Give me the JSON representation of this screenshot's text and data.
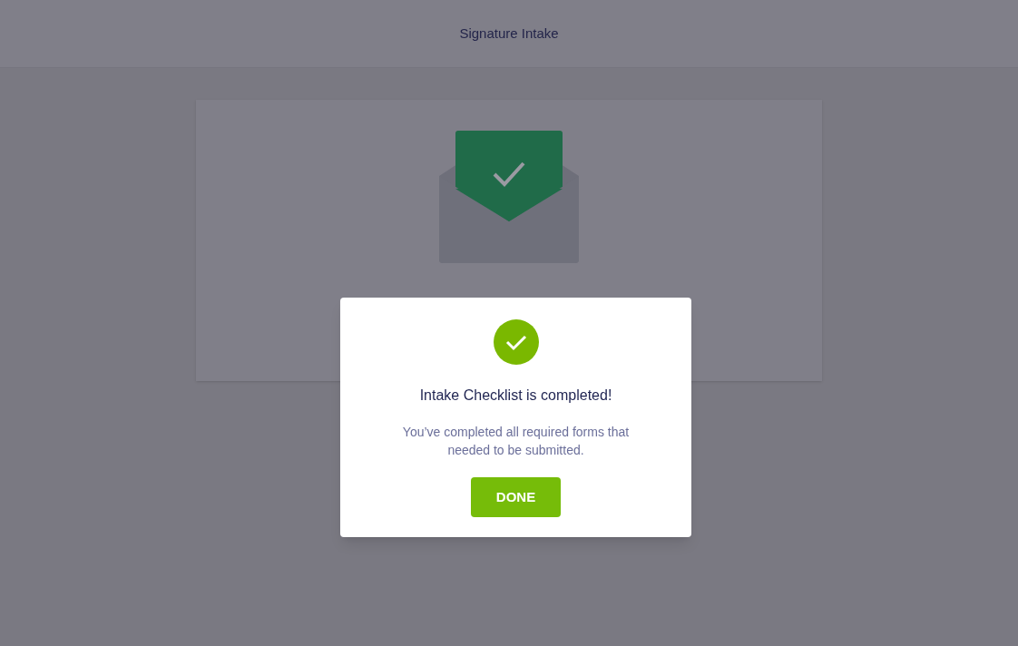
{
  "header": {
    "title": "Signature Intake"
  },
  "modal": {
    "title": "Intake Checklist is completed!",
    "message": "You’ve completed all required forms that needed to be submitted.",
    "button": "DONE"
  }
}
